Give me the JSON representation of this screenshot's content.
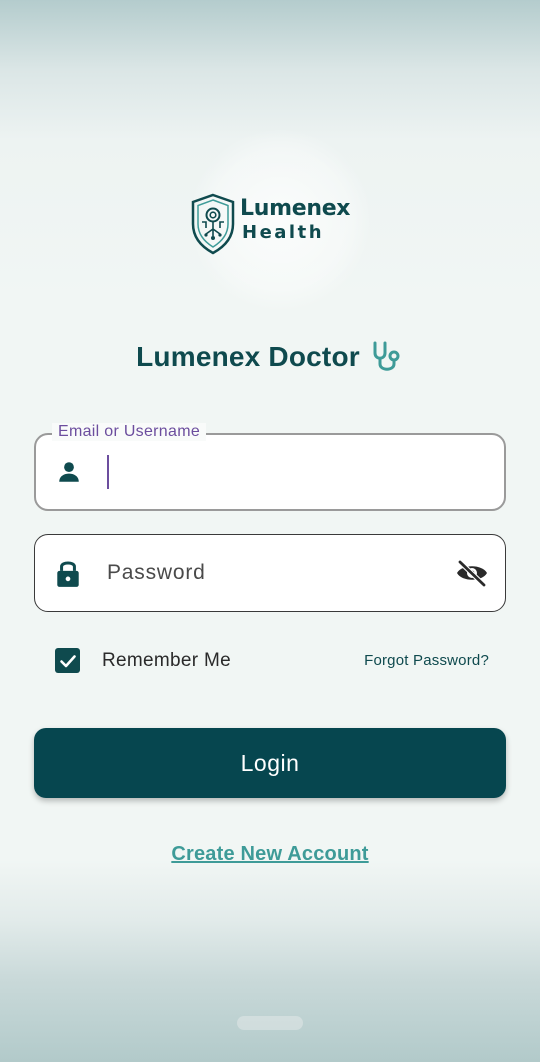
{
  "logo": {
    "line1": "Lumenex",
    "line2": "Health"
  },
  "app": {
    "title": "Lumenex Doctor",
    "title_icon": "stethoscope-icon"
  },
  "email_field": {
    "label": "Email or Username",
    "value": "",
    "icon": "person-icon"
  },
  "password_field": {
    "placeholder": "Password",
    "value": "",
    "icon": "lock-icon",
    "toggle_icon": "eye-off-icon"
  },
  "remember": {
    "label": "Remember Me",
    "checked": true
  },
  "forgot_label": "Forgot Password?",
  "login_label": "Login",
  "create_account_label": "Create New Account",
  "colors": {
    "primary": "#06464f",
    "accent": "#3e9b98",
    "label_purple": "#6c4e9e",
    "background": "#f1f6f4"
  }
}
